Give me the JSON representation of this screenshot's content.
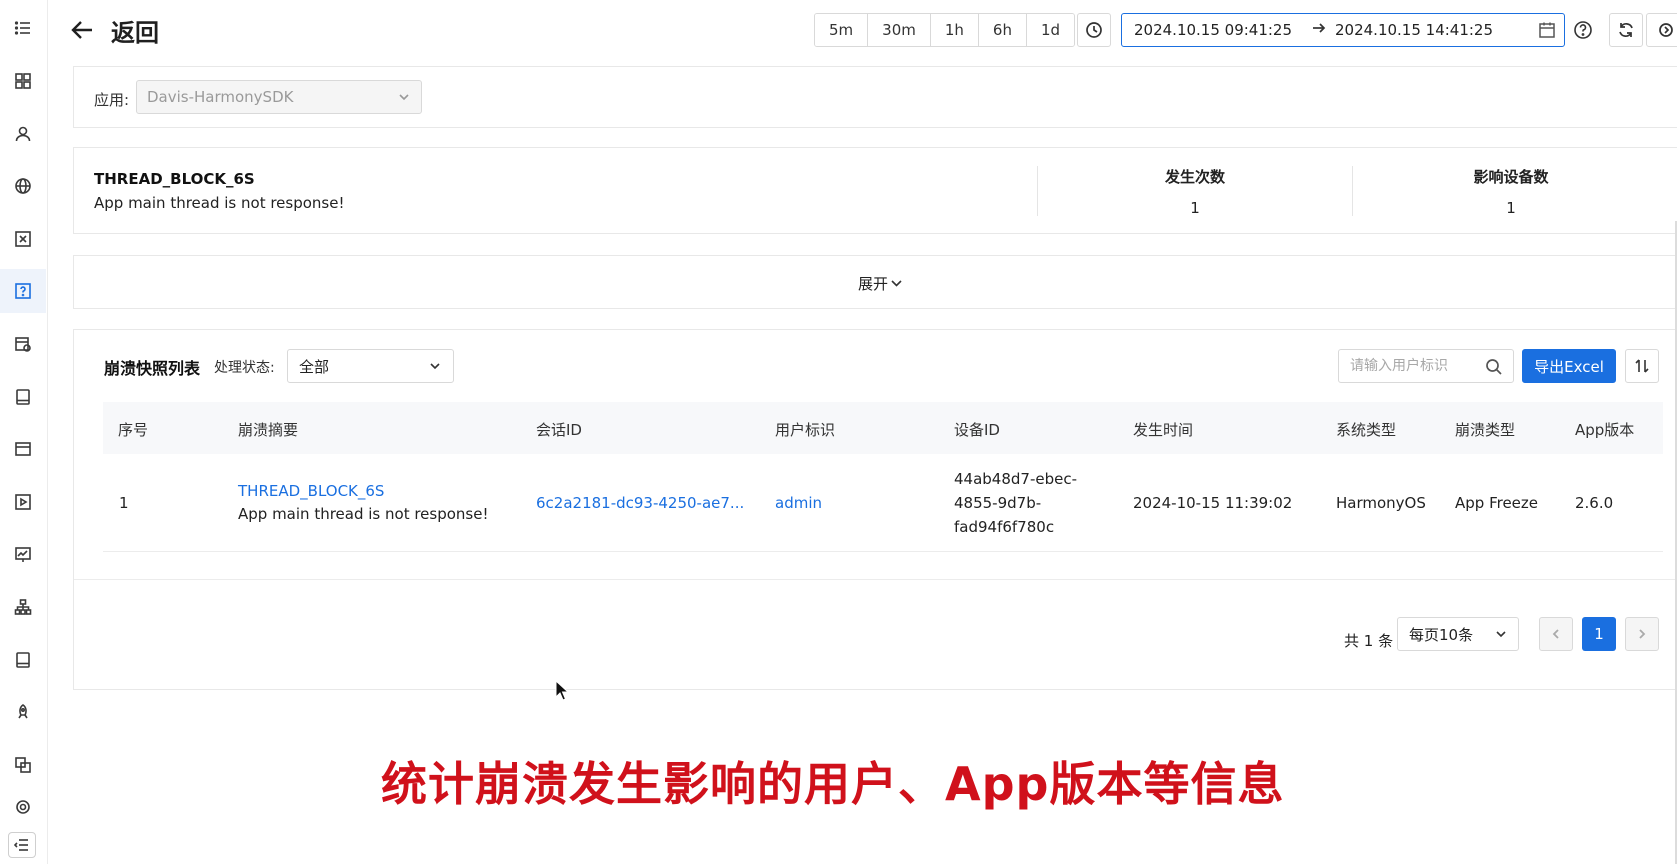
{
  "header": {
    "back_label": "返回",
    "ranges": [
      "5m",
      "30m",
      "1h",
      "6h",
      "1d"
    ],
    "date_start": "2024.10.15 09:41:25",
    "date_end": "2024.10.15 14:41:25"
  },
  "filter": {
    "app_label": "应用:",
    "app_value": "Davis-HarmonySDK"
  },
  "summary": {
    "title": "THREAD_BLOCK_6S",
    "description": "App main thread is not response!",
    "occurrences_label": "发生次数",
    "occurrences_value": "1",
    "devices_label": "影响设备数",
    "devices_value": "1"
  },
  "expand": {
    "label": "展开"
  },
  "list": {
    "title": "崩溃快照列表",
    "status_label": "处理状态:",
    "status_value": "全部",
    "search_placeholder": "请输入用户标识",
    "export_label": "导出Excel",
    "columns": [
      "序号",
      "崩溃摘要",
      "会话ID",
      "用户标识",
      "设备ID",
      "发生时间",
      "系统类型",
      "崩溃类型",
      "App版本"
    ],
    "rows": [
      {
        "index": "1",
        "summary_title": "THREAD_BLOCK_6S",
        "summary_desc": "App main thread is not response!",
        "session_id": "6c2a2181-dc93-4250-ae7...",
        "user": "admin",
        "device_id_lines": [
          "44ab48d7-ebec-",
          "4855-9d7b-",
          "fad94f6f780c"
        ],
        "time": "2024-10-15 11:39:02",
        "os": "HarmonyOS",
        "crash_type": "App Freeze",
        "app_version": "2.6.0"
      }
    ]
  },
  "pagination": {
    "total": "共 1 条",
    "page_size": "每页10条",
    "current_page": "1"
  },
  "caption": "统计崩溃发生影响的用户、App版本等信息",
  "colors": {
    "accent": "#1a6fe0",
    "caption": "#d0111b"
  }
}
